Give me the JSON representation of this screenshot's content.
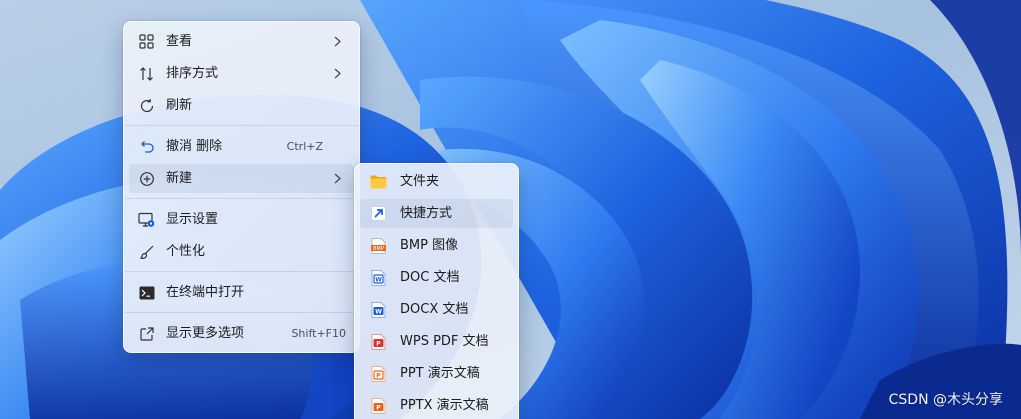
{
  "context_menu": {
    "items": [
      {
        "label": "查看",
        "icon": "grid-icon",
        "has_submenu": true
      },
      {
        "label": "排序方式",
        "icon": "sort-arrows-icon",
        "has_submenu": true
      },
      {
        "label": "刷新",
        "icon": "refresh-icon"
      },
      {
        "label": "撤消 删除",
        "icon": "undo-icon",
        "shortcut": "Ctrl+Z"
      },
      {
        "label": "新建",
        "icon": "add-circle-icon",
        "has_submenu": true,
        "highlighted": true
      },
      {
        "label": "显示设置",
        "icon": "display-settings-icon"
      },
      {
        "label": "个性化",
        "icon": "brush-icon"
      },
      {
        "label": "在终端中打开",
        "icon": "terminal-icon"
      },
      {
        "label": "显示更多选项",
        "icon": "more-options-icon",
        "shortcut": "Shift+F10"
      }
    ]
  },
  "new_submenu": {
    "items": [
      {
        "label": "文件夹",
        "icon": "folder-icon"
      },
      {
        "label": "快捷方式",
        "icon": "shortcut-icon",
        "highlighted": true
      },
      {
        "label": "BMP 图像",
        "icon": "bmp-file-icon"
      },
      {
        "label": "DOC 文档",
        "icon": "doc-file-icon"
      },
      {
        "label": "DOCX 文档",
        "icon": "docx-file-icon"
      },
      {
        "label": "WPS PDF 文档",
        "icon": "pdf-file-icon"
      },
      {
        "label": "PPT 演示文稿",
        "icon": "ppt-file-icon"
      },
      {
        "label": "PPTX 演示文稿",
        "icon": "pptx-file-icon"
      }
    ]
  },
  "watermark": "CSDN @木头分享",
  "colors": {
    "accent_blue": "#1a5fd8",
    "wallpaper_sky": "#b9cfe6",
    "menu_background": "#e9f0fa"
  }
}
